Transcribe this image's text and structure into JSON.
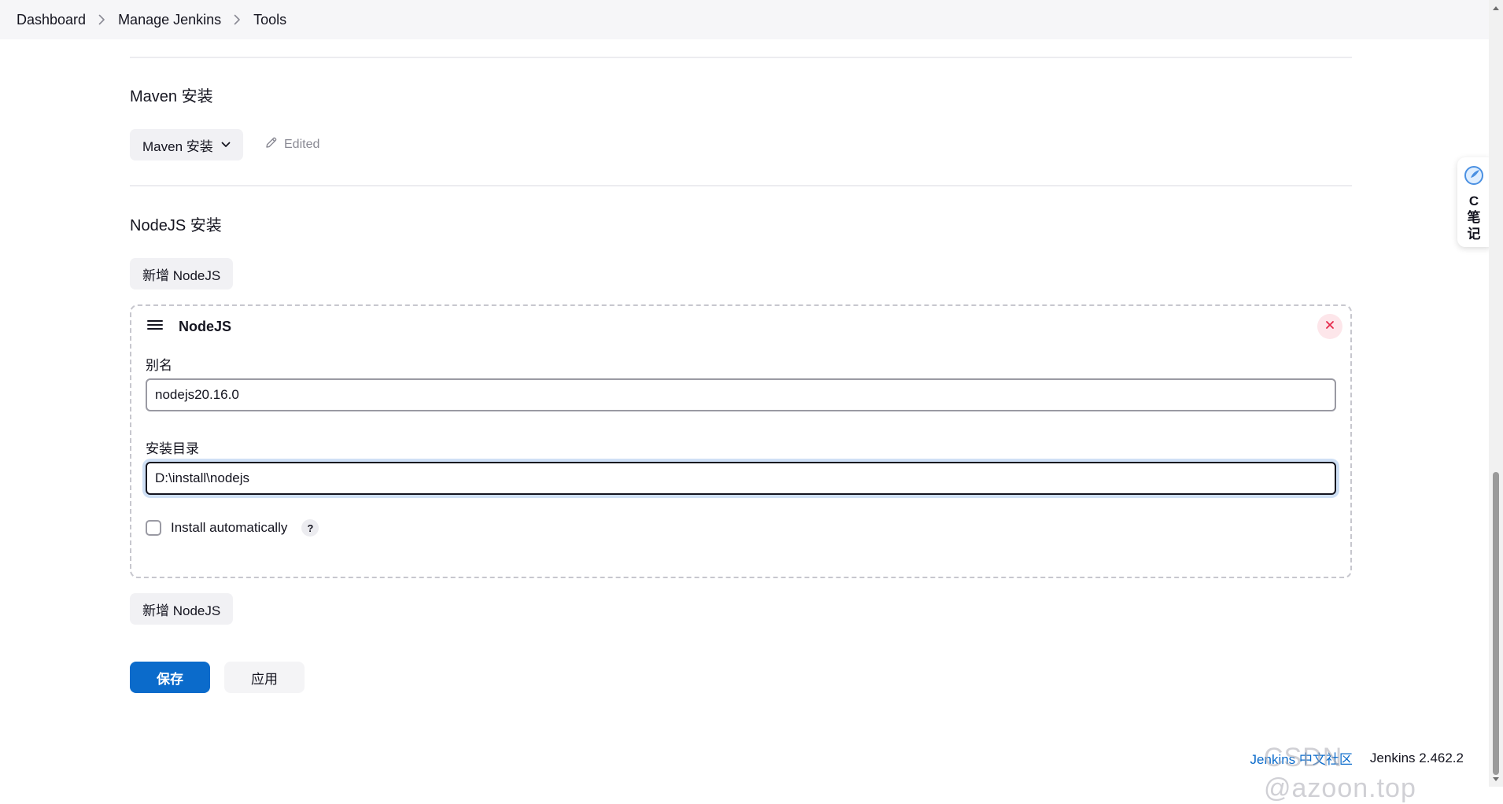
{
  "breadcrumb": {
    "items": [
      "Dashboard",
      "Manage Jenkins",
      "Tools"
    ]
  },
  "maven": {
    "section_title": "Maven 安装",
    "dropdown_label": "Maven 安装",
    "edited_label": "Edited"
  },
  "nodejs": {
    "section_title": "NodeJS 安装",
    "add_button_top": "新增 NodeJS",
    "add_button_bottom": "新增 NodeJS",
    "card": {
      "title": "NodeJS",
      "alias_label": "别名",
      "alias_value": "nodejs20.16.0",
      "install_dir_label": "安装目录",
      "install_dir_value": "D:\\install\\nodejs",
      "install_auto_label": "Install automatically",
      "install_auto_checked": false,
      "help_label": "?"
    }
  },
  "actions": {
    "save_label": "保存",
    "apply_label": "应用"
  },
  "footer": {
    "community_link": "Jenkins 中文社区",
    "version": "Jenkins 2.462.2",
    "watermark": "CSDN @azoon.top"
  },
  "side_widget": {
    "text": "C笔记"
  },
  "colors": {
    "primary": "#0b6bcb",
    "danger": "#e6294b",
    "border": "#9a9aa3"
  }
}
